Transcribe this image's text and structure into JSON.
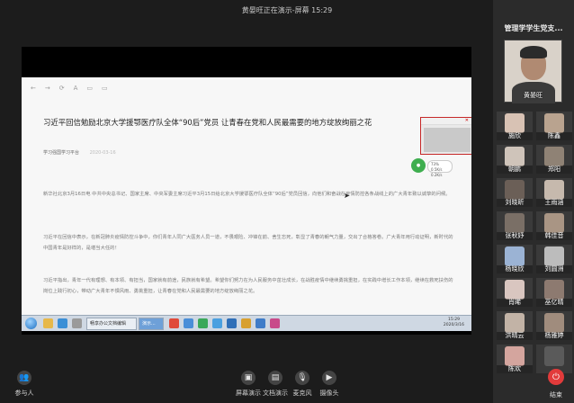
{
  "window": {
    "title": "黄晏旺正在演示-屏幕 15:29",
    "controls": [
      "minimize-icon",
      "maximize-icon",
      "close-icon"
    ]
  },
  "sidebar": {
    "title": "管理学学生党支...",
    "presenter_label": "黄晏旺",
    "participants": [
      {
        "name": "施欣",
        "color": "#d8c2b4"
      },
      {
        "name": "陈鑫",
        "color": "#b9a38f"
      },
      {
        "name": "朝鹏",
        "color": "#cfc4ba"
      },
      {
        "name": "郑阳",
        "color": "#8f8275"
      },
      {
        "name": "刘晓昕",
        "color": "#6b5f57"
      },
      {
        "name": "王雨涵",
        "color": "#c6b9ad"
      },
      {
        "name": "张秋妤",
        "color": "#7a6f66"
      },
      {
        "name": "韩佳音",
        "color": "#a99584"
      },
      {
        "name": "杨晓欣",
        "color": "#9bb3d4"
      },
      {
        "name": "刘圆洲",
        "color": "#bcbcbc"
      },
      {
        "name": "肖晞",
        "color": "#d9c6c0"
      },
      {
        "name": "巫亿晴",
        "color": "#8d7a70"
      },
      {
        "name": "洪晴云",
        "color": "#c2b3a6"
      },
      {
        "name": "杨雅婷",
        "color": "#a08c7d"
      },
      {
        "name": "陈欢",
        "color": "#d4a59e"
      },
      {
        "name": "",
        "color": "#5a5a5a"
      }
    ],
    "end_label": "结束"
  },
  "shared_screen": {
    "toolbar_icons": [
      "back-icon",
      "forward-icon",
      "refresh-icon",
      "text-icon",
      "window-icon",
      "window-icon"
    ],
    "article": {
      "title": "习近平回信勉励北京大学援鄂医疗队全体“90后”党员 让青春在党和人民最需要的地方绽放绚丽之花",
      "source": "学习强国学习平台",
      "date": "2020-03-16",
      "paragraphs": [
        "新华社北京3月16日电 中共中央总书记、国家主席、中央军委主席习近平3月15日给北京大学援鄂医疗队全体“90后”党员回信，向他们和奋战在疫情防控各条战线上的广大青年致以诚挚的问候。",
        "习近平在回信中表示，在新冠肺炎疫情防控斗争中，你们青年人同广大医务人员一道，不畏艰险、冲锋在前、舍生忘死，彰显了青春的朝气力量，交出了合格答卷。广大青年用行动证明，新时代的中国青年是好样的，是堪当大任的！",
        "习近平指出，青年一代有理想、有本领、有担当，国家就有前途，民族就有希望。希望你们努力在为人民服务中茁壮成长，在战胜疫情中继续勇挑重担，在实践中增长工作本领，继续在救死扶伤的岗位上践行初心，带动广大青年不惧风雨、勇挑重担，让青春在党和人民最需要的地方绽放绚丽之花。"
      ]
    },
    "stat_chip": "73%\n0.5K/s\n0.2K/s",
    "taskbar": {
      "task_labels": [
        "畅享办公文档编辑",
        "演示..."
      ],
      "clock_time": "15:29",
      "clock_date": "2020/3/16"
    }
  },
  "bottom_bar": {
    "participants_label": "参与人",
    "screen_demo_label": "屏幕演示",
    "doc_demo_label": "文档演示",
    "mic_label": "麦克风",
    "camera_label": "摄像头"
  }
}
